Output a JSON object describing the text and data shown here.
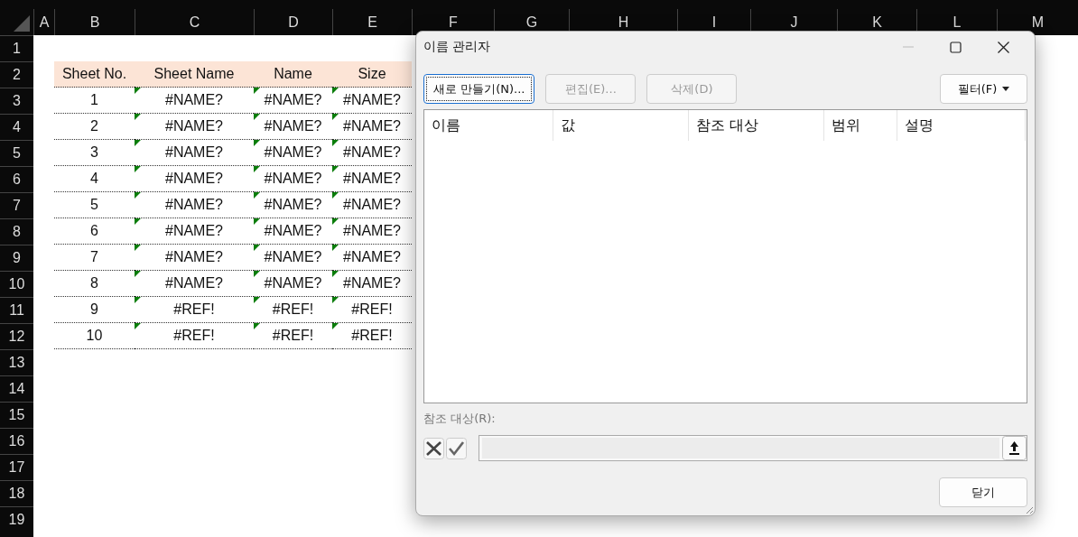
{
  "sheet": {
    "columns": [
      "A",
      "B",
      "C",
      "D",
      "E",
      "F",
      "G",
      "H",
      "I",
      "J",
      "K",
      "L",
      "M"
    ],
    "rows": [
      "1",
      "2",
      "3",
      "4",
      "5",
      "6",
      "7",
      "8",
      "9",
      "10",
      "11",
      "12",
      "13",
      "14",
      "15",
      "16",
      "17",
      "18",
      "19"
    ],
    "table": {
      "headers": [
        "Sheet No.",
        "Sheet Name",
        "Name",
        "Size"
      ],
      "rows": [
        {
          "no": "1",
          "values": [
            "#NAME?",
            "#NAME?",
            "#NAME?"
          ],
          "error_marks": [
            true,
            true,
            true
          ]
        },
        {
          "no": "2",
          "values": [
            "#NAME?",
            "#NAME?",
            "#NAME?"
          ],
          "error_marks": [
            true,
            true,
            true
          ]
        },
        {
          "no": "3",
          "values": [
            "#NAME?",
            "#NAME?",
            "#NAME?"
          ],
          "error_marks": [
            true,
            true,
            true
          ]
        },
        {
          "no": "4",
          "values": [
            "#NAME?",
            "#NAME?",
            "#NAME?"
          ],
          "error_marks": [
            true,
            true,
            true
          ]
        },
        {
          "no": "5",
          "values": [
            "#NAME?",
            "#NAME?",
            "#NAME?"
          ],
          "error_marks": [
            true,
            true,
            true
          ]
        },
        {
          "no": "6",
          "values": [
            "#NAME?",
            "#NAME?",
            "#NAME?"
          ],
          "error_marks": [
            true,
            true,
            true
          ]
        },
        {
          "no": "7",
          "values": [
            "#NAME?",
            "#NAME?",
            "#NAME?"
          ],
          "error_marks": [
            true,
            true,
            true
          ]
        },
        {
          "no": "8",
          "values": [
            "#NAME?",
            "#NAME?",
            "#NAME?"
          ],
          "error_marks": [
            true,
            true,
            true
          ]
        },
        {
          "no": "9",
          "values": [
            "#REF!",
            "#REF!",
            "#REF!"
          ],
          "error_marks": [
            true,
            true,
            true
          ]
        },
        {
          "no": "10",
          "values": [
            "#REF!",
            "#REF!",
            "#REF!"
          ],
          "error_marks": [
            true,
            true,
            true
          ]
        }
      ]
    }
  },
  "dialog": {
    "title": "이름 관리자",
    "buttons": [
      {
        "label": "새로 만들기(N)...",
        "disabled": false,
        "focused": true
      },
      {
        "label": "편집(E)...",
        "disabled": true,
        "focused": false
      },
      {
        "label": "삭제(D)",
        "disabled": true,
        "focused": false
      }
    ],
    "filter_button": {
      "label": "필터(F)"
    },
    "list": {
      "columns": [
        "이름",
        "값",
        "참조 대상",
        "범위",
        "설명"
      ]
    },
    "refers_to": {
      "label": "참조 대상(R):",
      "disabled": true
    },
    "close_button": {
      "label": "닫기"
    }
  }
}
